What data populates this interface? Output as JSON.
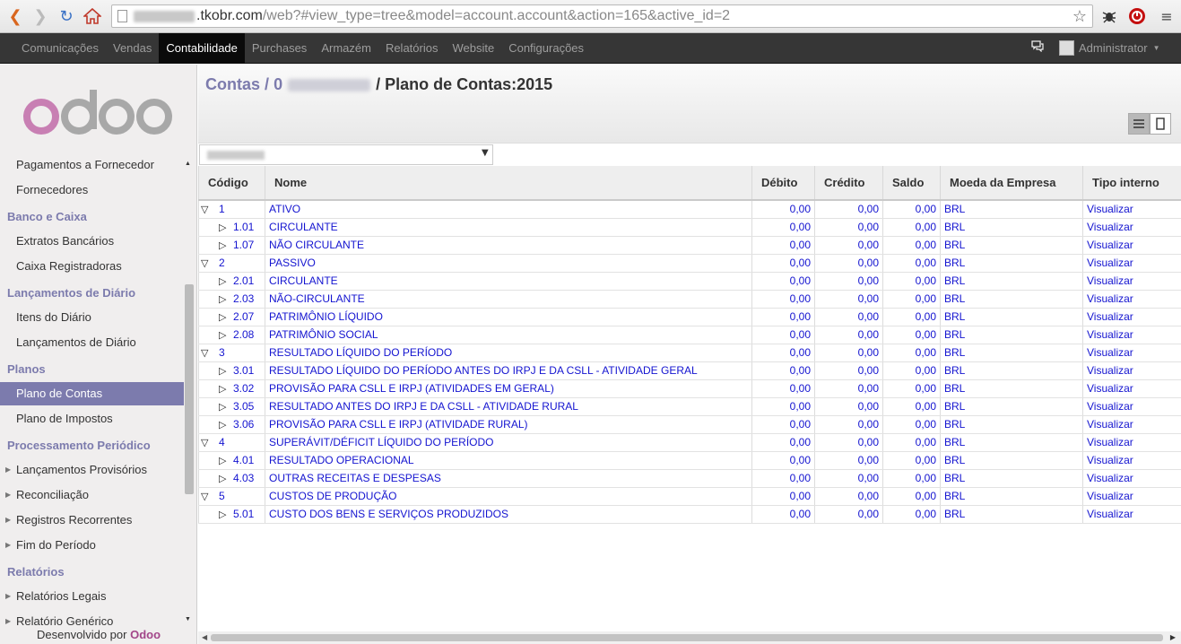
{
  "browser": {
    "url_host": ".tkobr.com",
    "url_rest": "/web?#view_type=tree&model=account.account&action=165&active_id=2"
  },
  "topmenu": {
    "items": [
      "Comunicações",
      "Vendas",
      "Contabilidade",
      "Purchases",
      "Armazém",
      "Relatórios",
      "Website",
      "Configurações"
    ],
    "active": "Contabilidade",
    "user": "Administrator"
  },
  "sidebar": {
    "logo_text": "odoo",
    "items": {
      "pagamentos": "Pagamentos a Fornecedor",
      "fornecedores": "Fornecedores",
      "banco_caixa": "Banco e Caixa",
      "extratos": "Extratos Bancários",
      "caixa": "Caixa Registradoras",
      "lanc_diario_head": "Lançamentos de Diário",
      "itens_diario": "Itens do Diário",
      "lanc_diario": "Lançamentos de Diário",
      "planos": "Planos",
      "plano_contas": "Plano de Contas",
      "plano_impostos": "Plano de Impostos",
      "processamento": "Processamento Periódico",
      "lanc_provisorios": "Lançamentos Provisórios",
      "reconciliacao": "Reconciliação",
      "registros": "Registros Recorrentes",
      "fim_periodo": "Fim do Período",
      "relatorios": "Relatórios",
      "rel_legais": "Relatórios Legais",
      "rel_generico": "Relatório Genérico"
    },
    "footer_prefix": "Desenvolvido por",
    "footer_brand": "Odoo"
  },
  "breadcrumb": {
    "contas": "Contas",
    "sep1": "/",
    "zero": "0",
    "sep2": "/",
    "current": "Plano de Contas:2015"
  },
  "colors": {
    "accent": "#7c7bad",
    "link": "#1414d0",
    "topbar": "#363636"
  },
  "table": {
    "headers": [
      "Código",
      "Nome",
      "Débito",
      "Crédito",
      "Saldo",
      "Moeda da Empresa",
      "Tipo interno"
    ],
    "rows": [
      {
        "code": "1",
        "name": "ATIVO",
        "debit": "0,00",
        "credit": "0,00",
        "balance": "0,00",
        "currency": "BRL",
        "type": "Visualizar",
        "level": 0,
        "expanded": true
      },
      {
        "code": "1.01",
        "name": "CIRCULANTE",
        "debit": "0,00",
        "credit": "0,00",
        "balance": "0,00",
        "currency": "BRL",
        "type": "Visualizar",
        "level": 1,
        "expanded": false
      },
      {
        "code": "1.07",
        "name": "NÃO CIRCULANTE",
        "debit": "0,00",
        "credit": "0,00",
        "balance": "0,00",
        "currency": "BRL",
        "type": "Visualizar",
        "level": 1,
        "expanded": false
      },
      {
        "code": "2",
        "name": "PASSIVO",
        "debit": "0,00",
        "credit": "0,00",
        "balance": "0,00",
        "currency": "BRL",
        "type": "Visualizar",
        "level": 0,
        "expanded": true
      },
      {
        "code": "2.01",
        "name": "CIRCULANTE",
        "debit": "0,00",
        "credit": "0,00",
        "balance": "0,00",
        "currency": "BRL",
        "type": "Visualizar",
        "level": 1,
        "expanded": false
      },
      {
        "code": "2.03",
        "name": "NÃO-CIRCULANTE",
        "debit": "0,00",
        "credit": "0,00",
        "balance": "0,00",
        "currency": "BRL",
        "type": "Visualizar",
        "level": 1,
        "expanded": false
      },
      {
        "code": "2.07",
        "name": "PATRIMÔNIO LÍQUIDO",
        "debit": "0,00",
        "credit": "0,00",
        "balance": "0,00",
        "currency": "BRL",
        "type": "Visualizar",
        "level": 1,
        "expanded": false
      },
      {
        "code": "2.08",
        "name": "PATRIMÔNIO SOCIAL",
        "debit": "0,00",
        "credit": "0,00",
        "balance": "0,00",
        "currency": "BRL",
        "type": "Visualizar",
        "level": 1,
        "expanded": false
      },
      {
        "code": "3",
        "name": "RESULTADO LÍQUIDO DO PERÍODO",
        "debit": "0,00",
        "credit": "0,00",
        "balance": "0,00",
        "currency": "BRL",
        "type": "Visualizar",
        "level": 0,
        "expanded": true
      },
      {
        "code": "3.01",
        "name": "RESULTADO LÍQUIDO DO PERÍODO ANTES DO IRPJ E DA CSLL - ATIVIDADE GERAL",
        "debit": "0,00",
        "credit": "0,00",
        "balance": "0,00",
        "currency": "BRL",
        "type": "Visualizar",
        "level": 1,
        "expanded": false
      },
      {
        "code": "3.02",
        "name": "PROVISÃO PARA CSLL E IRPJ (ATIVIDADES EM GERAL)",
        "debit": "0,00",
        "credit": "0,00",
        "balance": "0,00",
        "currency": "BRL",
        "type": "Visualizar",
        "level": 1,
        "expanded": false
      },
      {
        "code": "3.05",
        "name": "RESULTADO ANTES DO IRPJ E DA CSLL - ATIVIDADE RURAL",
        "debit": "0,00",
        "credit": "0,00",
        "balance": "0,00",
        "currency": "BRL",
        "type": "Visualizar",
        "level": 1,
        "expanded": false
      },
      {
        "code": "3.06",
        "name": "PROVISÃO PARA CSLL E IRPJ (ATIVIDADE RURAL)",
        "debit": "0,00",
        "credit": "0,00",
        "balance": "0,00",
        "currency": "BRL",
        "type": "Visualizar",
        "level": 1,
        "expanded": false
      },
      {
        "code": "4",
        "name": "SUPERÁVIT/DÉFICIT LÍQUIDO DO PERÍODO",
        "debit": "0,00",
        "credit": "0,00",
        "balance": "0,00",
        "currency": "BRL",
        "type": "Visualizar",
        "level": 0,
        "expanded": true
      },
      {
        "code": "4.01",
        "name": "RESULTADO OPERACIONAL",
        "debit": "0,00",
        "credit": "0,00",
        "balance": "0,00",
        "currency": "BRL",
        "type": "Visualizar",
        "level": 1,
        "expanded": false
      },
      {
        "code": "4.03",
        "name": "OUTRAS RECEITAS E DESPESAS",
        "debit": "0,00",
        "credit": "0,00",
        "balance": "0,00",
        "currency": "BRL",
        "type": "Visualizar",
        "level": 1,
        "expanded": false
      },
      {
        "code": "5",
        "name": "CUSTOS DE PRODUÇÃO",
        "debit": "0,00",
        "credit": "0,00",
        "balance": "0,00",
        "currency": "BRL",
        "type": "Visualizar",
        "level": 0,
        "expanded": true
      },
      {
        "code": "5.01",
        "name": "CUSTO DOS BENS E SERVIÇOS PRODUZIDOS",
        "debit": "0,00",
        "credit": "0,00",
        "balance": "0,00",
        "currency": "BRL",
        "type": "Visualizar",
        "level": 1,
        "expanded": false
      }
    ]
  }
}
